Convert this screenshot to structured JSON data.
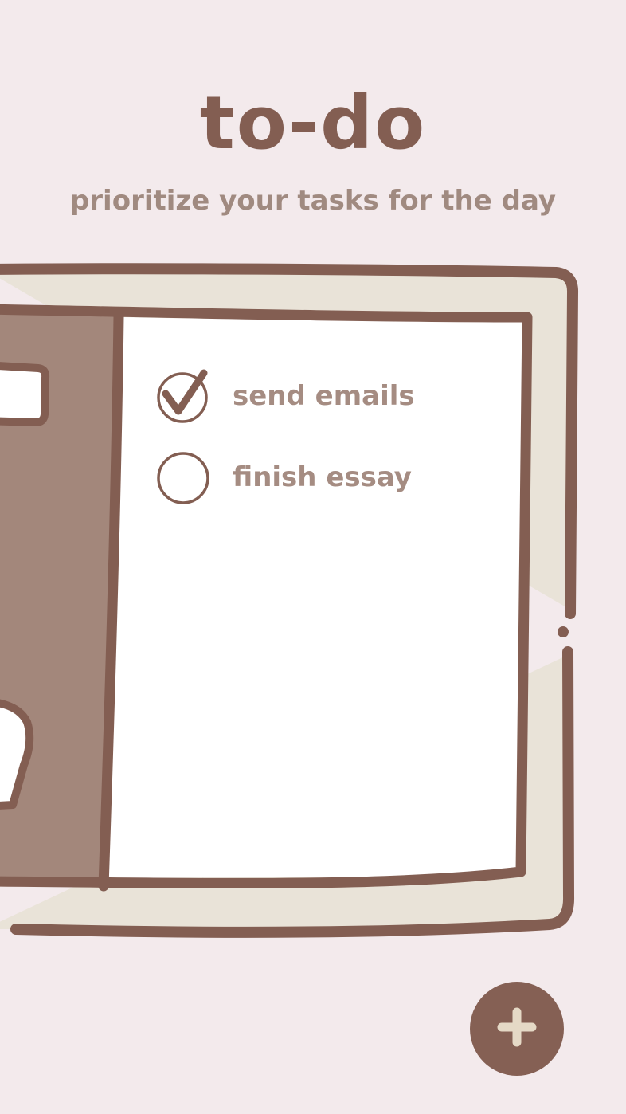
{
  "header": {
    "title": "to-do",
    "subtitle": "prioritize your tasks for the day"
  },
  "tasks": [
    {
      "label": "send emails",
      "completed": true
    },
    {
      "label": "finish essay",
      "completed": false
    }
  ],
  "fab": {
    "icon": "plus-icon"
  },
  "colors": {
    "background": "#f3eaec",
    "ink": "#835e52",
    "muted_text": "#a58c82",
    "notebook_cover": "#e9e3d8",
    "binding": "#a3877b",
    "page": "#ffffff",
    "fab_plus": "#e5d9c6"
  }
}
